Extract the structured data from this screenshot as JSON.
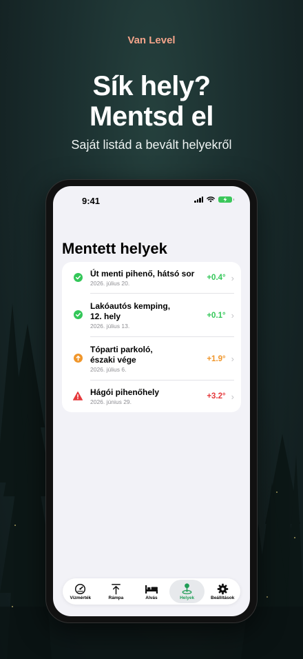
{
  "promo": {
    "brand": "Van Level",
    "headline_line1": "Sík hely?",
    "headline_line2": "Mentsd el",
    "subhead": "Saját listád a bevált helyekről"
  },
  "status_bar": {
    "time": "9:41"
  },
  "screen": {
    "title": "Mentett helyek",
    "places": [
      {
        "name": "Út menti pihenő, hátsó sor",
        "date": "2026. július 20.",
        "value": "+0.4°",
        "status": "ok",
        "icon": "check-circle-icon",
        "color": "#34c759"
      },
      {
        "name": "Lakóautós kemping,\n12. hely",
        "date": "2026. július 13.",
        "value": "+0.1°",
        "status": "ok",
        "icon": "check-circle-icon",
        "color": "#34c759"
      },
      {
        "name": "Tóparti parkoló,\nészaki vége",
        "date": "2026. július 6.",
        "value": "+1.9°",
        "status": "warning",
        "icon": "arrow-up-circle-icon",
        "color": "#f0962b"
      },
      {
        "name": "Hágói pihenőhely",
        "date": "2026. június 29.",
        "value": "+3.2°",
        "status": "alert",
        "icon": "warning-triangle-icon",
        "color": "#e5383b"
      }
    ]
  },
  "tabbar": {
    "tabs": [
      {
        "label": "Vízmérték",
        "icon": "gauge-icon",
        "active": false
      },
      {
        "label": "Rámpa",
        "icon": "arrow-up-bar-icon",
        "active": false
      },
      {
        "label": "Alvás",
        "icon": "bed-icon",
        "active": false
      },
      {
        "label": "Helyek",
        "icon": "map-pin-icon",
        "active": true
      },
      {
        "label": "Beállítások",
        "icon": "gear-icon",
        "active": false
      }
    ]
  },
  "colors": {
    "brand": "#f2a48a",
    "ok": "#34c759",
    "warning": "#f0962b",
    "alert": "#e5383b",
    "active_tab": "#1f9d55"
  }
}
